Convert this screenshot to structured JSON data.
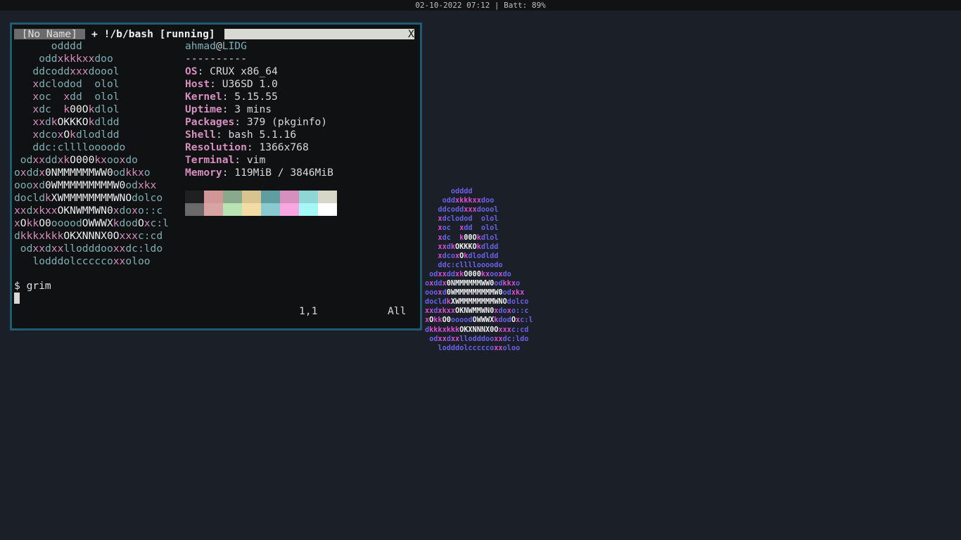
{
  "status_bar": {
    "text": "02-10-2022 07:12 | Batt: 89%"
  },
  "vim": {
    "tabs": [
      {
        "label": " [No Name] "
      },
      {
        "label": "+ !/b/bash [running]"
      }
    ],
    "close_label": "X",
    "command": "$ grim",
    "cursor_position": "1,1",
    "scroll_position": "All"
  },
  "logo_lines": [
    "      odddd",
    "    oddxkkkxxdoo",
    "   ddcoddxxxdoool",
    "   xdclodod  olol",
    "   xoc  xdd  olol",
    "   xdc  k00Okdlol",
    "   xxdkOKKKOkdldd",
    "   xdcoxOkdlodldd",
    "   ddc:clllloooodo",
    " odxxddxkO000kxooxdo",
    "oxddx0NMMMMMMWW0odkkxo",
    "oooxd0WMMMMMMMMMW0odxkx",
    "docldkXWMMMMMMMMWNOdolco",
    "xxdxkxxOKNWMMWN0xdoxo::c",
    "xOkkO0oooodOWWWXkdodOxc:l",
    "dkkkxkkkOKXNNNX0Oxxxc:cd",
    " odxxdxxllodddooxxdc:ldo",
    "   lodddolcccccoxxoloo"
  ],
  "sysinfo": {
    "user": "ahmad",
    "at": "@",
    "host": "LIDG",
    "separator": "----------",
    "fields": [
      {
        "key": "OS",
        "value": "CRUX x86_64"
      },
      {
        "key": "Host",
        "value": "U36SD 1.0"
      },
      {
        "key": "Kernel",
        "value": "5.15.55"
      },
      {
        "key": "Uptime",
        "value": "3 mins"
      },
      {
        "key": "Packages",
        "value": "379 (pkginfo)"
      },
      {
        "key": "Shell",
        "value": "bash 5.1.16"
      },
      {
        "key": "Resolution",
        "value": "1366x768"
      },
      {
        "key": "Terminal",
        "value": "vim"
      },
      {
        "key": "Memory",
        "value": "119MiB / 3846MiB"
      }
    ]
  },
  "palette": {
    "normal": [
      "#202020",
      "#d39696",
      "#8aa88b",
      "#d8c48f",
      "#5f9ea0",
      "#d78fbf",
      "#8fd6d6",
      "#d7d7c8"
    ],
    "bright": [
      "#6a6a6a",
      "#d8a3a3",
      "#b8e4b4",
      "#f2dca3",
      "#88cacf",
      "#f7a6e1",
      "#a8f7f7",
      "#ffffff"
    ]
  },
  "colors": {
    "logo_teal": "#7fb0b5",
    "logo_white": "#f0f0f0",
    "logo_pink": "#d78fbf",
    "bg_logo_blue": "#6a62e6",
    "bg_logo_pink": "#d94fd6",
    "bg_logo_white": "#f0f0f0"
  }
}
